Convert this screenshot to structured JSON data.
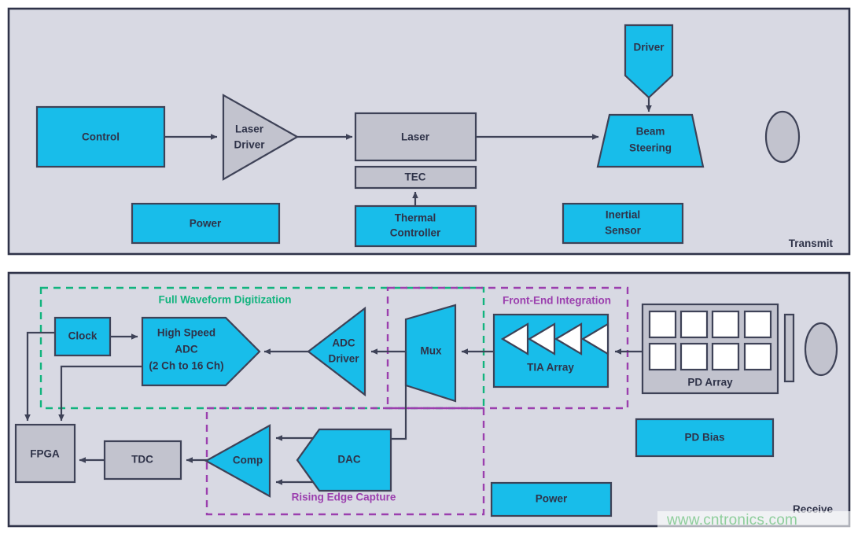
{
  "theme": {
    "cyan": "#18bdea",
    "gray": "#c2c3ce",
    "panel_bg": "#d8d9e3",
    "outline": "#3e4257",
    "group_green": "#12b47e",
    "group_purple": "#9b3fae",
    "watermark_color": "#8fce9c"
  },
  "transmit": {
    "corner_label": "Transmit",
    "blocks": {
      "control": "Control",
      "laser_driver_line1": "Laser",
      "laser_driver_line2": "Driver",
      "laser": "Laser",
      "tec": "TEC",
      "thermal_controller_line1": "Thermal",
      "thermal_controller_line2": "Controller",
      "power": "Power",
      "driver": "Driver",
      "beam_steering_line1": "Beam",
      "beam_steering_line2": "Steering",
      "inertial_sensor_line1": "Inertial",
      "inertial_sensor_line2": "Sensor",
      "lens": ""
    }
  },
  "receive": {
    "corner_label": "Receive",
    "groups": {
      "full_waveform": "Full Waveform Digitization",
      "front_end": "Front-End Integration",
      "rising_edge": "Rising Edge Capture"
    },
    "blocks": {
      "clock": "Clock",
      "adc_line1": "High Speed",
      "adc_line2": "ADC",
      "adc_line3": "(2 Ch to 16 Ch)",
      "adc_driver_line1": "ADC",
      "adc_driver_line2": "Driver",
      "mux": "Mux",
      "tia_array": "TIA Array",
      "pd_array": "PD Array",
      "pd_bias": "PD Bias",
      "power": "Power",
      "fpga": "FPGA",
      "tdc": "TDC",
      "comp": "Comp",
      "dac": "DAC"
    },
    "tia_channels": 4,
    "pd_cells": 8
  },
  "watermark": {
    "text": "www.cntronics.com"
  }
}
